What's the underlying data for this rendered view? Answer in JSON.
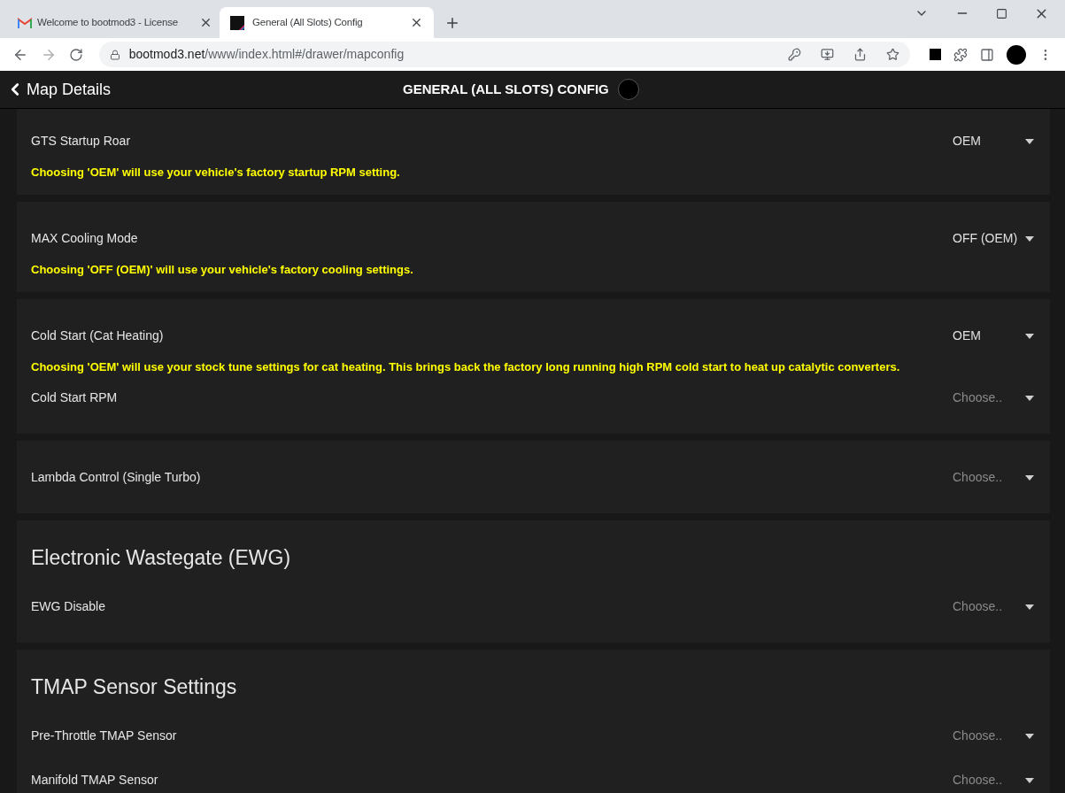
{
  "browser": {
    "tabs": [
      {
        "title": "Welcome to bootmod3 - License",
        "selected": false,
        "kind": "mail"
      },
      {
        "title": "General (All Slots) Config",
        "selected": true,
        "kind": "site"
      }
    ],
    "url": {
      "host": "bootmod3.net",
      "path": "/www/index.html#/drawer/mapconfig"
    }
  },
  "header": {
    "back_label": "Map Details",
    "title": "GENERAL (ALL SLOTS) CONFIG"
  },
  "cards": [
    {
      "rows": [
        {
          "kind": "select",
          "label": "GTS Startup Roar",
          "value": "OEM"
        },
        {
          "kind": "note",
          "text": "Choosing 'OEM' will use your vehicle's factory startup RPM setting."
        }
      ]
    },
    {
      "rows": [
        {
          "kind": "select",
          "label": "MAX Cooling Mode",
          "value": "OFF (OEM)"
        },
        {
          "kind": "note",
          "text": "Choosing 'OFF (OEM)' will use your vehicle's factory cooling settings."
        }
      ]
    },
    {
      "rows": [
        {
          "kind": "select",
          "label": "Cold Start (Cat Heating)",
          "value": "OEM"
        },
        {
          "kind": "note",
          "text": "Choosing 'OEM' will use your stock tune settings for cat heating. This brings back the factory long running high RPM cold start to heat up catalytic converters."
        },
        {
          "kind": "select",
          "label": "Cold Start RPM",
          "placeholder": "Choose.."
        }
      ]
    },
    {
      "rows": [
        {
          "kind": "select",
          "label": "Lambda Control (Single Turbo)",
          "placeholder": "Choose.."
        }
      ]
    },
    {
      "heading": "Electronic Wastegate (EWG)",
      "rows": [
        {
          "kind": "select",
          "label": "EWG Disable",
          "placeholder": "Choose.."
        }
      ]
    },
    {
      "heading": "TMAP Sensor Settings",
      "rows": [
        {
          "kind": "select",
          "label": "Pre-Throttle TMAP Sensor",
          "placeholder": "Choose.."
        },
        {
          "kind": "select",
          "label": "Manifold TMAP Sensor",
          "placeholder": "Choose.."
        }
      ]
    }
  ]
}
